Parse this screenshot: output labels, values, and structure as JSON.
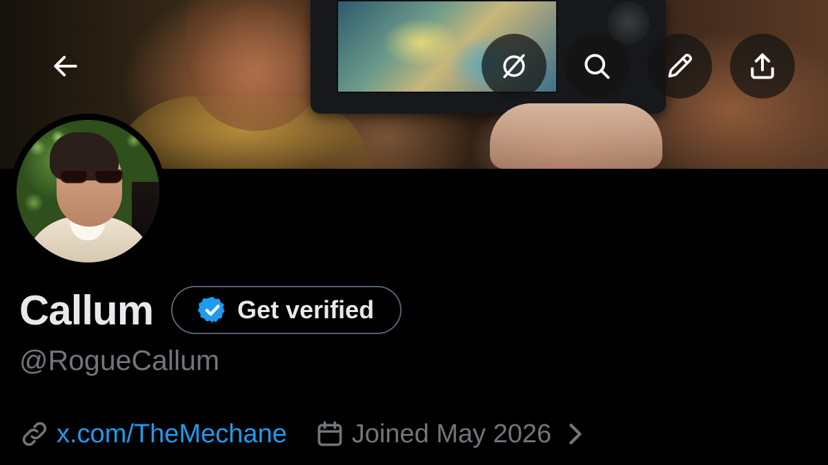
{
  "profile": {
    "display_name": "Callum",
    "handle": "@RogueCallum",
    "verify_button_label": "Get verified",
    "website": "x.com/TheMechane",
    "joined": "Joined May 2026"
  },
  "icons": {
    "back": "arrow-left-icon",
    "grok": "grok-icon",
    "search": "search-icon",
    "edit": "pencil-icon",
    "share": "share-icon",
    "verified": "verified-badge-icon",
    "link": "link-icon",
    "calendar": "calendar-icon",
    "chevron": "chevron-right-icon"
  },
  "colors": {
    "background": "#000000",
    "primary_text": "#e7e9ea",
    "secondary_text": "#71767b",
    "accent": "#1d9bf0",
    "border": "#536471"
  }
}
